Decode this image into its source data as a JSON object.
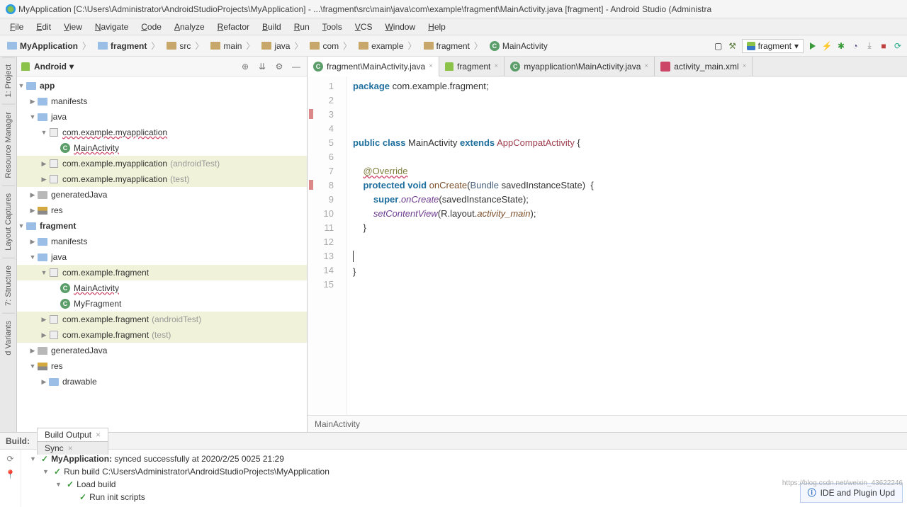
{
  "titlebar": {
    "text": "MyApplication [C:\\Users\\Administrator\\AndroidStudioProjects\\MyApplication] - ...\\fragment\\src\\main\\java\\com\\example\\fragment\\MainActivity.java [fragment] - Android Studio (Administra"
  },
  "menu": [
    "File",
    "Edit",
    "View",
    "Navigate",
    "Code",
    "Analyze",
    "Refactor",
    "Build",
    "Run",
    "Tools",
    "VCS",
    "Window",
    "Help"
  ],
  "breadcrumbs": [
    {
      "label": "MyApplication",
      "bold": true,
      "icon": "module"
    },
    {
      "label": "fragment",
      "bold": true,
      "icon": "module"
    },
    {
      "label": "src",
      "icon": "folder"
    },
    {
      "label": "main",
      "icon": "folder"
    },
    {
      "label": "java",
      "icon": "folder"
    },
    {
      "label": "com",
      "icon": "folder"
    },
    {
      "label": "example",
      "icon": "folder"
    },
    {
      "label": "fragment",
      "icon": "folder"
    },
    {
      "label": "MainActivity",
      "icon": "class"
    }
  ],
  "run_config": "fragment",
  "project_view": {
    "label": "Android"
  },
  "side_tabs": [
    "1: Project",
    "Resource Manager",
    "Layout Captures",
    "7: Structure",
    "d Variants"
  ],
  "tree": [
    {
      "d": 0,
      "exp": "open",
      "icon": "module",
      "label": "app",
      "bold": true
    },
    {
      "d": 1,
      "exp": "closed",
      "icon": "folder",
      "label": "manifests"
    },
    {
      "d": 1,
      "exp": "open",
      "icon": "folder",
      "label": "java"
    },
    {
      "d": 2,
      "exp": "open",
      "icon": "pkg",
      "label": "com.example.myapplication",
      "wavy": true
    },
    {
      "d": 3,
      "exp": "",
      "icon": "class",
      "label": "MainActivity",
      "wavy": true
    },
    {
      "d": 2,
      "exp": "closed",
      "icon": "pkg",
      "label": "com.example.myapplication",
      "suffix": "(androidTest)",
      "hl": true
    },
    {
      "d": 2,
      "exp": "closed",
      "icon": "pkg",
      "label": "com.example.myapplication",
      "suffix": "(test)",
      "hl": true
    },
    {
      "d": 1,
      "exp": "closed",
      "icon": "gen",
      "label": "generatedJava"
    },
    {
      "d": 1,
      "exp": "closed",
      "icon": "res",
      "label": "res"
    },
    {
      "d": 0,
      "exp": "open",
      "icon": "module",
      "label": "fragment",
      "bold": true
    },
    {
      "d": 1,
      "exp": "closed",
      "icon": "folder",
      "label": "manifests"
    },
    {
      "d": 1,
      "exp": "open",
      "icon": "folder",
      "label": "java"
    },
    {
      "d": 2,
      "exp": "open",
      "icon": "pkg",
      "label": "com.example.fragment",
      "hl": true
    },
    {
      "d": 3,
      "exp": "",
      "icon": "class",
      "label": "MainActivity",
      "wavy": true,
      "sel": false
    },
    {
      "d": 3,
      "exp": "",
      "icon": "class",
      "label": "MyFragment",
      "sel": false
    },
    {
      "d": 2,
      "exp": "closed",
      "icon": "pkg",
      "label": "com.example.fragment",
      "suffix": "(androidTest)",
      "hl": true
    },
    {
      "d": 2,
      "exp": "closed",
      "icon": "pkg",
      "label": "com.example.fragment",
      "suffix": "(test)",
      "hl": true
    },
    {
      "d": 1,
      "exp": "closed",
      "icon": "gen",
      "label": "generatedJava"
    },
    {
      "d": 1,
      "exp": "open",
      "icon": "res",
      "label": "res"
    },
    {
      "d": 2,
      "exp": "closed",
      "icon": "folder",
      "label": "drawable"
    }
  ],
  "tabs": [
    {
      "label": "fragment\\MainActivity.java",
      "icon": "class",
      "active": true
    },
    {
      "label": "fragment",
      "icon": "android",
      "active": false
    },
    {
      "label": "myapplication\\MainActivity.java",
      "icon": "class",
      "active": false
    },
    {
      "label": "activity_main.xml",
      "icon": "xml",
      "active": false
    }
  ],
  "code": {
    "lines": [
      {
        "n": 1,
        "html": "<span class='k-kw'>package</span> <span class='k-plain'>com.example.fragment;</span>"
      },
      {
        "n": 2,
        "html": ""
      },
      {
        "n": 3,
        "html": "",
        "mark": true
      },
      {
        "n": 4,
        "html": ""
      },
      {
        "n": 5,
        "html": "<span class='k-kw'>public class</span> <span class='k-plain'>MainActivity</span> <span class='k-kw'>extends</span> <span class='k-cls'>AppCompatActivity</span> <span class='k-plain'>{</span>"
      },
      {
        "n": 6,
        "html": ""
      },
      {
        "n": 7,
        "html": "    <span class='k-ann wavy'>@Override</span>"
      },
      {
        "n": 8,
        "html": "    <span class='k-kw'>protected void</span> <span class='k-mthd'>onCreate</span>(<span class='k-type'>Bundle</span> savedInstanceState)  {",
        "mark": true
      },
      {
        "n": 9,
        "html": "        <span class='k-kw'>super</span>.<span class='k-call'>onCreate</span>(savedInstanceState);"
      },
      {
        "n": 10,
        "html": "        <span class='k-call'>setContentView</span>(R.layout.<span class='k-field'>activity_main</span>);"
      },
      {
        "n": 11,
        "html": "    }"
      },
      {
        "n": 12,
        "html": ""
      },
      {
        "n": 13,
        "html": "",
        "caret": true
      },
      {
        "n": 14,
        "html": "}"
      },
      {
        "n": 15,
        "html": ""
      }
    ]
  },
  "editor_breadcrumb": "MainActivity",
  "build": {
    "panel_label": "Build:",
    "tabs": [
      {
        "label": "Build Output",
        "active": true
      },
      {
        "label": "Sync",
        "active": false
      }
    ],
    "rows": [
      {
        "d": 0,
        "exp": "open",
        "chk": true,
        "bold": "MyApplication:",
        "text": " synced successfully at 2020/2/25 0025 21:29"
      },
      {
        "d": 1,
        "exp": "open",
        "chk": true,
        "text": "Run build C:\\Users\\Administrator\\AndroidStudioProjects\\MyApplication"
      },
      {
        "d": 2,
        "exp": "open",
        "chk": true,
        "text": "Load build"
      },
      {
        "d": 3,
        "exp": "",
        "chk": true,
        "text": "Run init scripts"
      }
    ],
    "notice": "IDE and Plugin Upd"
  },
  "watermark": "https://blog.csdn.net/weixin_43622246"
}
